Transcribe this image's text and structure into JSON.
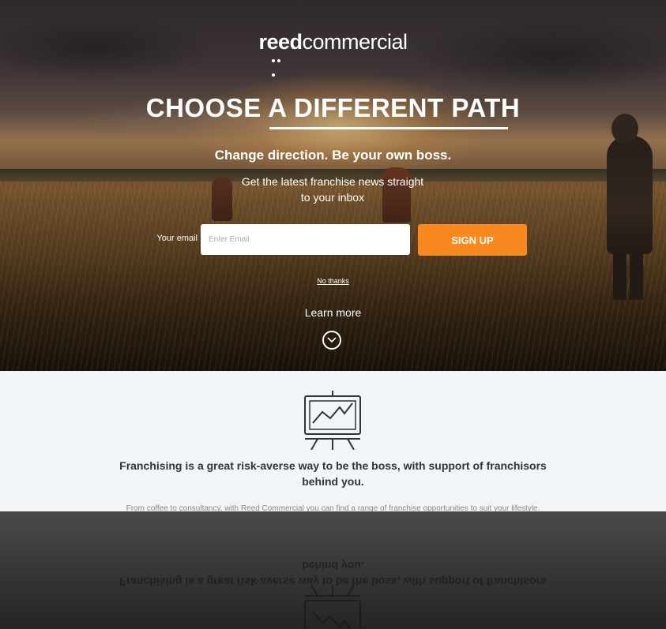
{
  "brand": {
    "logo_bold": "reed",
    "logo_light": "commercial"
  },
  "hero": {
    "headline": "CHOOSE A DIFFERENT PATH",
    "subhead": "Change direction. Be your own boss.",
    "tagline": "Get the latest franchise news straight to your inbox"
  },
  "form": {
    "email_label": "Your email",
    "email_placeholder": "Enter Email",
    "email_value": "",
    "signup_label": "SIGN UP"
  },
  "links": {
    "no_thanks": "No thanks",
    "learn_more": "Learn more"
  },
  "feature": {
    "icon": "presentation-board-chart-icon",
    "heading": "Franchising is a great risk-averse way to be the boss, with support of franchisors behind you.",
    "body": "From coffee to consultancy, with Reed Commercial you can find a range of franchise opportunities to suit your lifestyle."
  },
  "colors": {
    "accent": "#f7891f",
    "lower_bg": "#f2f5f8",
    "text_dark": "#333333"
  }
}
